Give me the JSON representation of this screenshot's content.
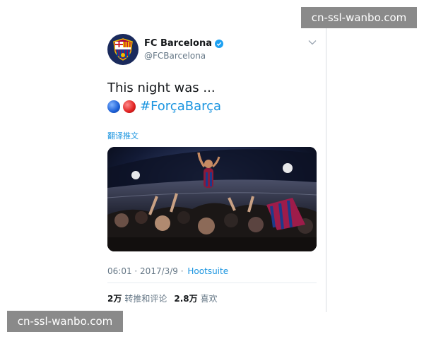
{
  "account": {
    "display_name": "FC Barcelona",
    "handle": "@FCBarcelona",
    "verified": true
  },
  "tweet": {
    "text_line1": "This night was ...",
    "hashtag": "#ForçaBarça",
    "emoji": [
      "blue-circle",
      "red-circle"
    ],
    "translate_label": "翻译推文"
  },
  "meta": {
    "time": "06:01",
    "separator1": " · ",
    "date": "2017/3/9",
    "separator2": " · ",
    "source": "Hootsuite"
  },
  "stats": {
    "retweets_count": "2万",
    "retweets_label": "转推和评论",
    "likes_count": "2.8万",
    "likes_label": "喜欢"
  },
  "watermarks": {
    "top": "cn-ssl-wanbo.com",
    "bottom": "cn-ssl-wanbo.com"
  },
  "colors": {
    "link": "#1b95e0",
    "secondary_text": "#657786",
    "primary_text": "#14171a",
    "verified": "#1da1f2"
  }
}
